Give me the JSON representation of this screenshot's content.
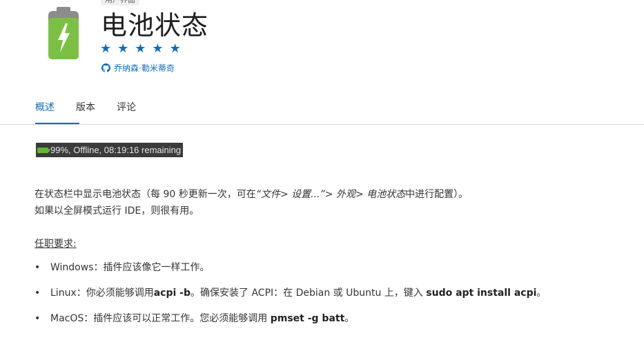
{
  "header": {
    "category": "用户界面",
    "title": "电池状态",
    "rating_stars": 5,
    "author": "乔纳森·勒米蒂奇",
    "icon": "battery-charging-icon",
    "author_icon": "github-icon",
    "colors": {
      "accent": "#0f6cbd",
      "battery_green": "#7ac143",
      "battery_cap": "#8c8c8c"
    }
  },
  "tabs": [
    {
      "label": "概述",
      "active": true
    },
    {
      "label": "版本",
      "active": false
    },
    {
      "label": "评论",
      "active": false
    }
  ],
  "status_chip": {
    "text": "99%, Offline, 08:19:16 remaining"
  },
  "description": {
    "line1_prefix": "在状态栏中显示电池状态（每 90 秒更新一次，可在",
    "line1_path": "“文件> 设置...”> 外观> 电池状态",
    "line1_suffix": "中进行配置）。",
    "line2": "如果以全屏模式运行 IDE，则很有用。"
  },
  "requirements": {
    "title": "任职要求:",
    "items": [
      {
        "bullet": "•",
        "prefix": "Windows：插件应该像它一样工作。",
        "cmd": "",
        "mid": "",
        "cmd2": "",
        "suffix": ""
      },
      {
        "bullet": "•",
        "prefix": "Linux：你必须能够调用",
        "cmd": "acpi -b",
        "mid": "。确保安装了 ACPI：在 Debian 或 Ubuntu 上，键入 ",
        "cmd2": "sudo apt install acpi",
        "suffix": "。"
      },
      {
        "bullet": "•",
        "prefix": "MacOS：插件应该可以正常工作。您必须能够调用 ",
        "cmd": "pmset -g batt",
        "mid": "",
        "cmd2": "",
        "suffix": "。"
      }
    ]
  }
}
